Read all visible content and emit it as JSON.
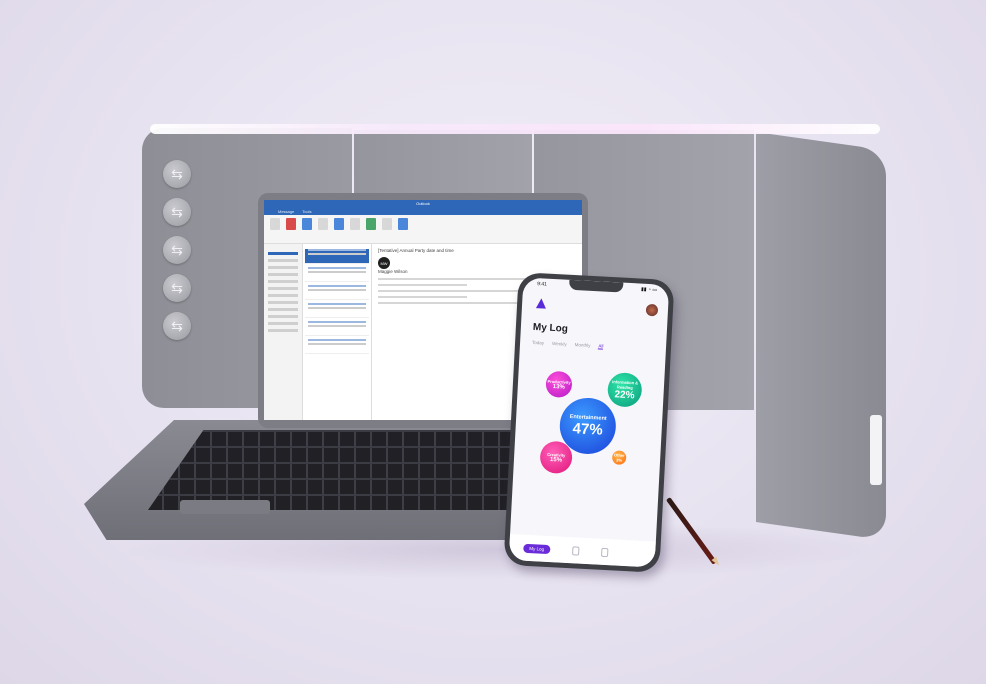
{
  "scene": {
    "description_tags": [
      "privacy-panel",
      "laptop",
      "smartphone",
      "pencil"
    ]
  },
  "laptop_app": {
    "window_title": "Outlook",
    "menu_tabs": [
      "Message",
      "Tools"
    ],
    "email_subject": "[Tentative] Annual Party date and time",
    "sender_initials": "MW",
    "sender_name": "Maggie Wilson"
  },
  "phone_app": {
    "status_time": "9:41",
    "status_indicators": "▮▮ ◔ ▭",
    "title": "My Log",
    "tabs": [
      {
        "label": "Today",
        "active": false
      },
      {
        "label": "Weekly",
        "active": false
      },
      {
        "label": "Monthly",
        "active": false
      },
      {
        "label": "All",
        "active": true
      }
    ],
    "bubbles": [
      {
        "label": "Entertainment",
        "percent": "47%",
        "color": "#2a6ff0"
      },
      {
        "label": "Information & Reading",
        "percent": "22%",
        "color": "#19c591"
      },
      {
        "label": "Productivity",
        "percent": "13%",
        "color": "#d92ad8"
      },
      {
        "label": "Creativity",
        "percent": "15%",
        "color": "#f0309a"
      },
      {
        "label": "Other",
        "percent": "3%",
        "color": "#ff8a25"
      }
    ],
    "nav": {
      "active_label": "My Log"
    }
  },
  "colors": {
    "accent": "#6a2bd8",
    "outlook_blue": "#2f67b8",
    "background": "#e9e4f1"
  }
}
